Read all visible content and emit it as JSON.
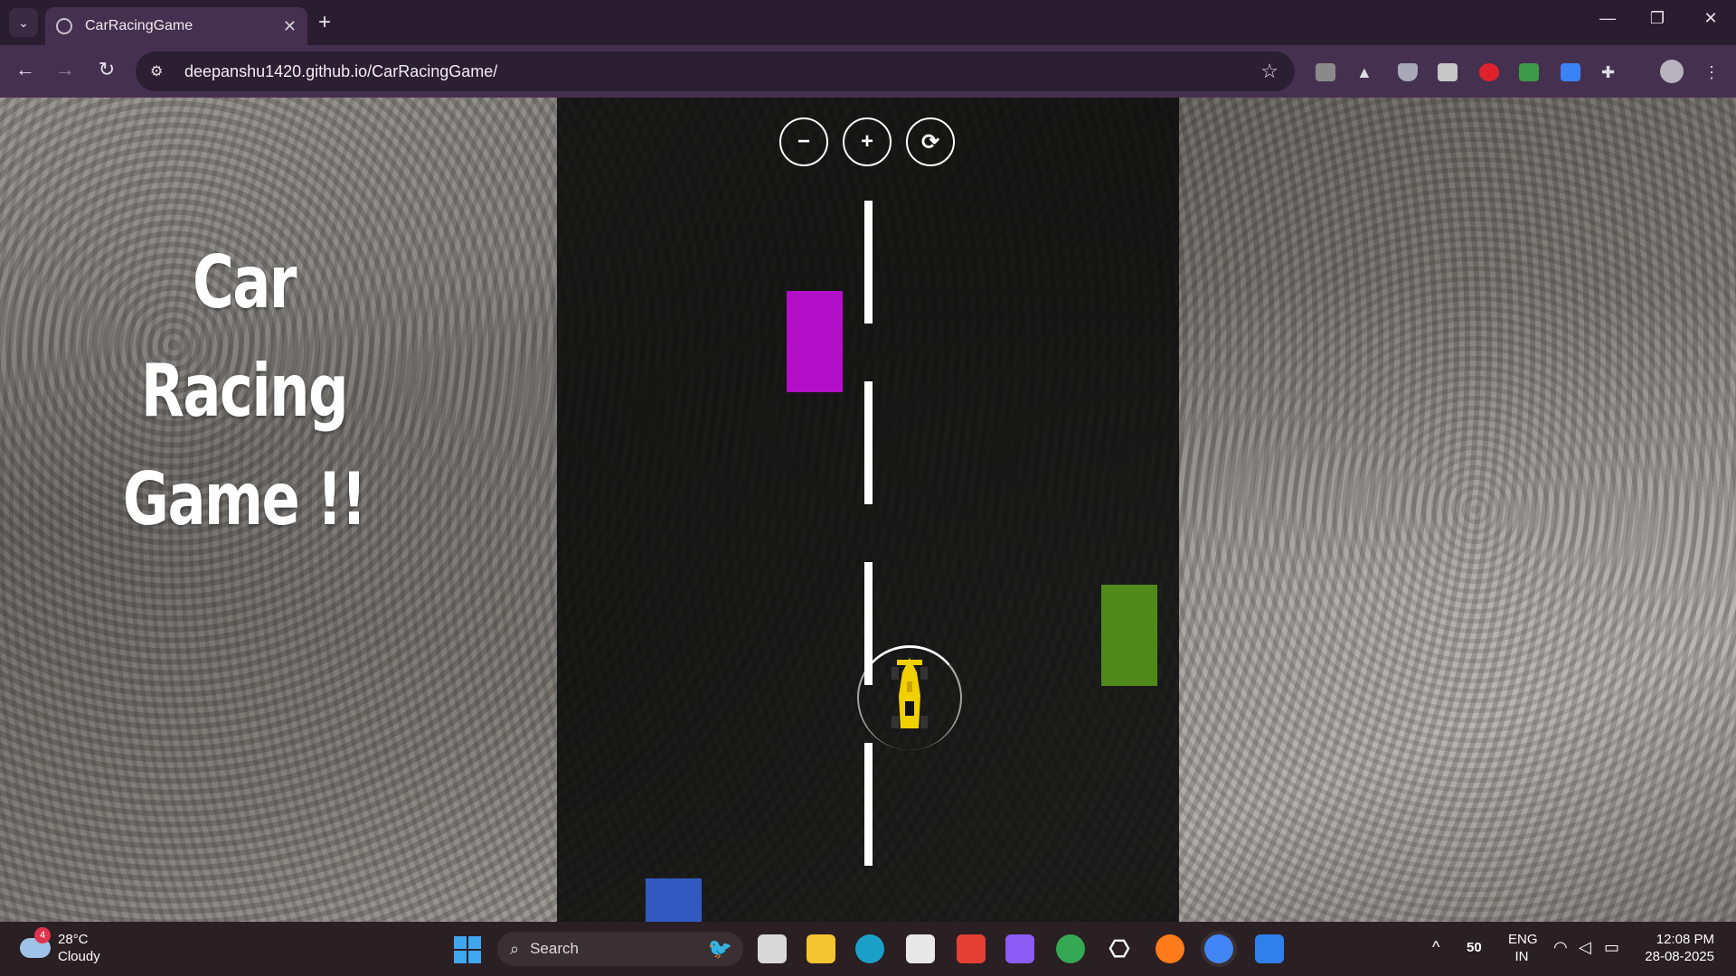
{
  "browser": {
    "tab_title": "CarRacingGame",
    "url": "deepanshu1420.github.io/CarRacingGame/",
    "new_tab_symbol": "+",
    "tab_close_symbol": "✕"
  },
  "page": {
    "heading_line1": "Car Racing",
    "heading_line2": "Game !!",
    "controls": {
      "minus": "−",
      "plus": "+",
      "restart": "⟳"
    },
    "obstacle_colors": {
      "purple": "#b40fc8",
      "green": "#4f8a1b",
      "blue": "#3159c0"
    },
    "player_car_color": "#f2d000"
  },
  "taskbar": {
    "weather_badge": "4",
    "temperature": "28°C",
    "condition": "Cloudy",
    "search_placeholder": "Search",
    "tray_number": "50",
    "language_line1": "ENG",
    "language_line2": "IN",
    "time": "12:08 PM",
    "date": "28-08-2025"
  }
}
